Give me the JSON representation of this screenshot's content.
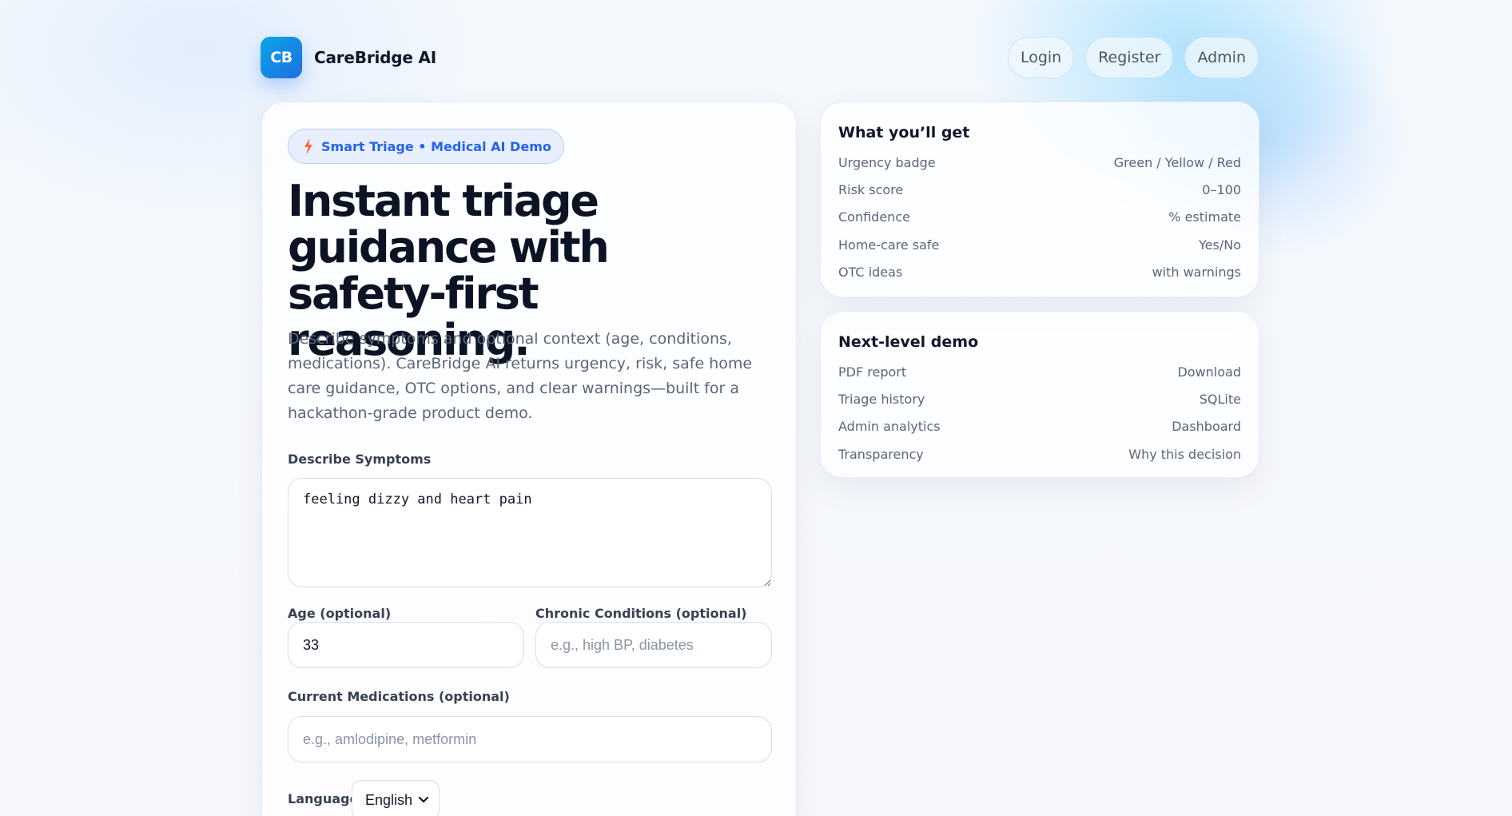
{
  "header": {
    "logo_text": "CB",
    "brand_name": "CareBridge AI",
    "nav": [
      "Login",
      "Register",
      "Admin"
    ]
  },
  "hero": {
    "badge_icon": "lightning-bolt-icon",
    "badge_text": "Smart Triage • Medical AI Demo",
    "headline": "Instant triage guidance with safety-first reasoning.",
    "description": "Describe symptoms and optional context (age, conditions, medications). CareBridge AI returns urgency, risk, safe home care guidance, OTC options, and clear warnings—built for a hackathon-grade product demo."
  },
  "form": {
    "symptoms_label": "Describe Symptoms",
    "symptoms_value": "feeling dizzy and heart pain",
    "age_label": "Age (optional)",
    "age_value": "33",
    "conditions_label": "Chronic Conditions (optional)",
    "conditions_placeholder": "e.g., high BP, diabetes",
    "medications_label": "Current Medications (optional)",
    "medications_placeholder": "e.g., amlodipine, metformin",
    "language_label": "Language",
    "language_value": "English"
  },
  "what_you_get": {
    "title": "What you’ll get",
    "rows": [
      {
        "label": "Urgency badge",
        "value": "Green / Yellow / Red"
      },
      {
        "label": "Risk score",
        "value": "0–100"
      },
      {
        "label": "Confidence",
        "value": "% estimate"
      },
      {
        "label": "Home-care safe",
        "value": "Yes/No"
      },
      {
        "label": "OTC ideas",
        "value": "with warnings"
      }
    ]
  },
  "next_level": {
    "title": "Next-level demo",
    "rows": [
      {
        "label": "PDF report",
        "value": "Download"
      },
      {
        "label": "Triage history",
        "value": "SQLite"
      },
      {
        "label": "Admin analytics",
        "value": "Dashboard"
      },
      {
        "label": "Transparency",
        "value": "Why this decision"
      }
    ]
  },
  "colors": {
    "accent": "#2563eb",
    "logo_gradient_start": "#0ea5e9",
    "logo_gradient_end": "#1d6fe0",
    "bolt": "#f26b4a"
  }
}
